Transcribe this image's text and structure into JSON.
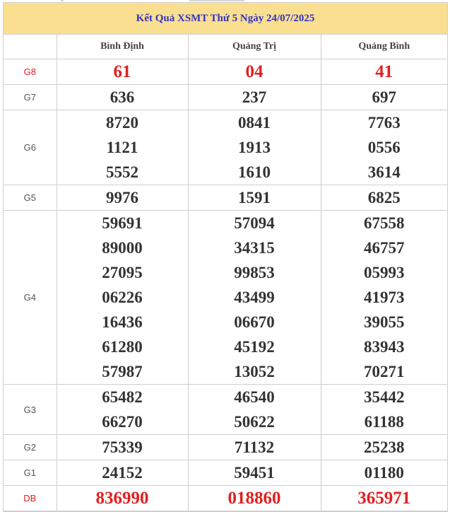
{
  "title": "Kết Quả XSMT Thứ 5 Ngày 24/07/2025",
  "provinces": [
    "Bình Định",
    "Quảng Trị",
    "Quảng Bình"
  ],
  "prizes": [
    {
      "label": "G8",
      "highlight": true,
      "values": [
        [
          "61"
        ],
        [
          "04"
        ],
        [
          "41"
        ]
      ]
    },
    {
      "label": "G7",
      "highlight": false,
      "values": [
        [
          "636"
        ],
        [
          "237"
        ],
        [
          "697"
        ]
      ]
    },
    {
      "label": "G6",
      "highlight": false,
      "values": [
        [
          "8720",
          "1121",
          "5552"
        ],
        [
          "0841",
          "1913",
          "1610"
        ],
        [
          "7763",
          "0556",
          "3614"
        ]
      ]
    },
    {
      "label": "G5",
      "highlight": false,
      "values": [
        [
          "9976"
        ],
        [
          "1591"
        ],
        [
          "6825"
        ]
      ]
    },
    {
      "label": "G4",
      "highlight": false,
      "values": [
        [
          "59691",
          "89000",
          "27095",
          "06226",
          "16436",
          "61280",
          "57987"
        ],
        [
          "57094",
          "34315",
          "99853",
          "43499",
          "06670",
          "45192",
          "13052"
        ],
        [
          "67558",
          "46757",
          "05993",
          "41973",
          "39055",
          "83943",
          "70271"
        ]
      ]
    },
    {
      "label": "G3",
      "highlight": false,
      "values": [
        [
          "65482",
          "66270"
        ],
        [
          "46540",
          "50622"
        ],
        [
          "35442",
          "61188"
        ]
      ]
    },
    {
      "label": "G2",
      "highlight": false,
      "values": [
        [
          "75339"
        ],
        [
          "71132"
        ],
        [
          "25238"
        ]
      ]
    },
    {
      "label": "G1",
      "highlight": false,
      "values": [
        [
          "24152"
        ],
        [
          "59451"
        ],
        [
          "01180"
        ]
      ]
    },
    {
      "label": "DB",
      "highlight": true,
      "values": [
        [
          "836990"
        ],
        [
          "018860"
        ],
        [
          "365971"
        ]
      ]
    }
  ],
  "colors": {
    "title_bg": "#f9df8f",
    "title_text": "#3232c8",
    "highlight": "#e02020",
    "number": "#333333",
    "grid": "#cfcfcf"
  }
}
